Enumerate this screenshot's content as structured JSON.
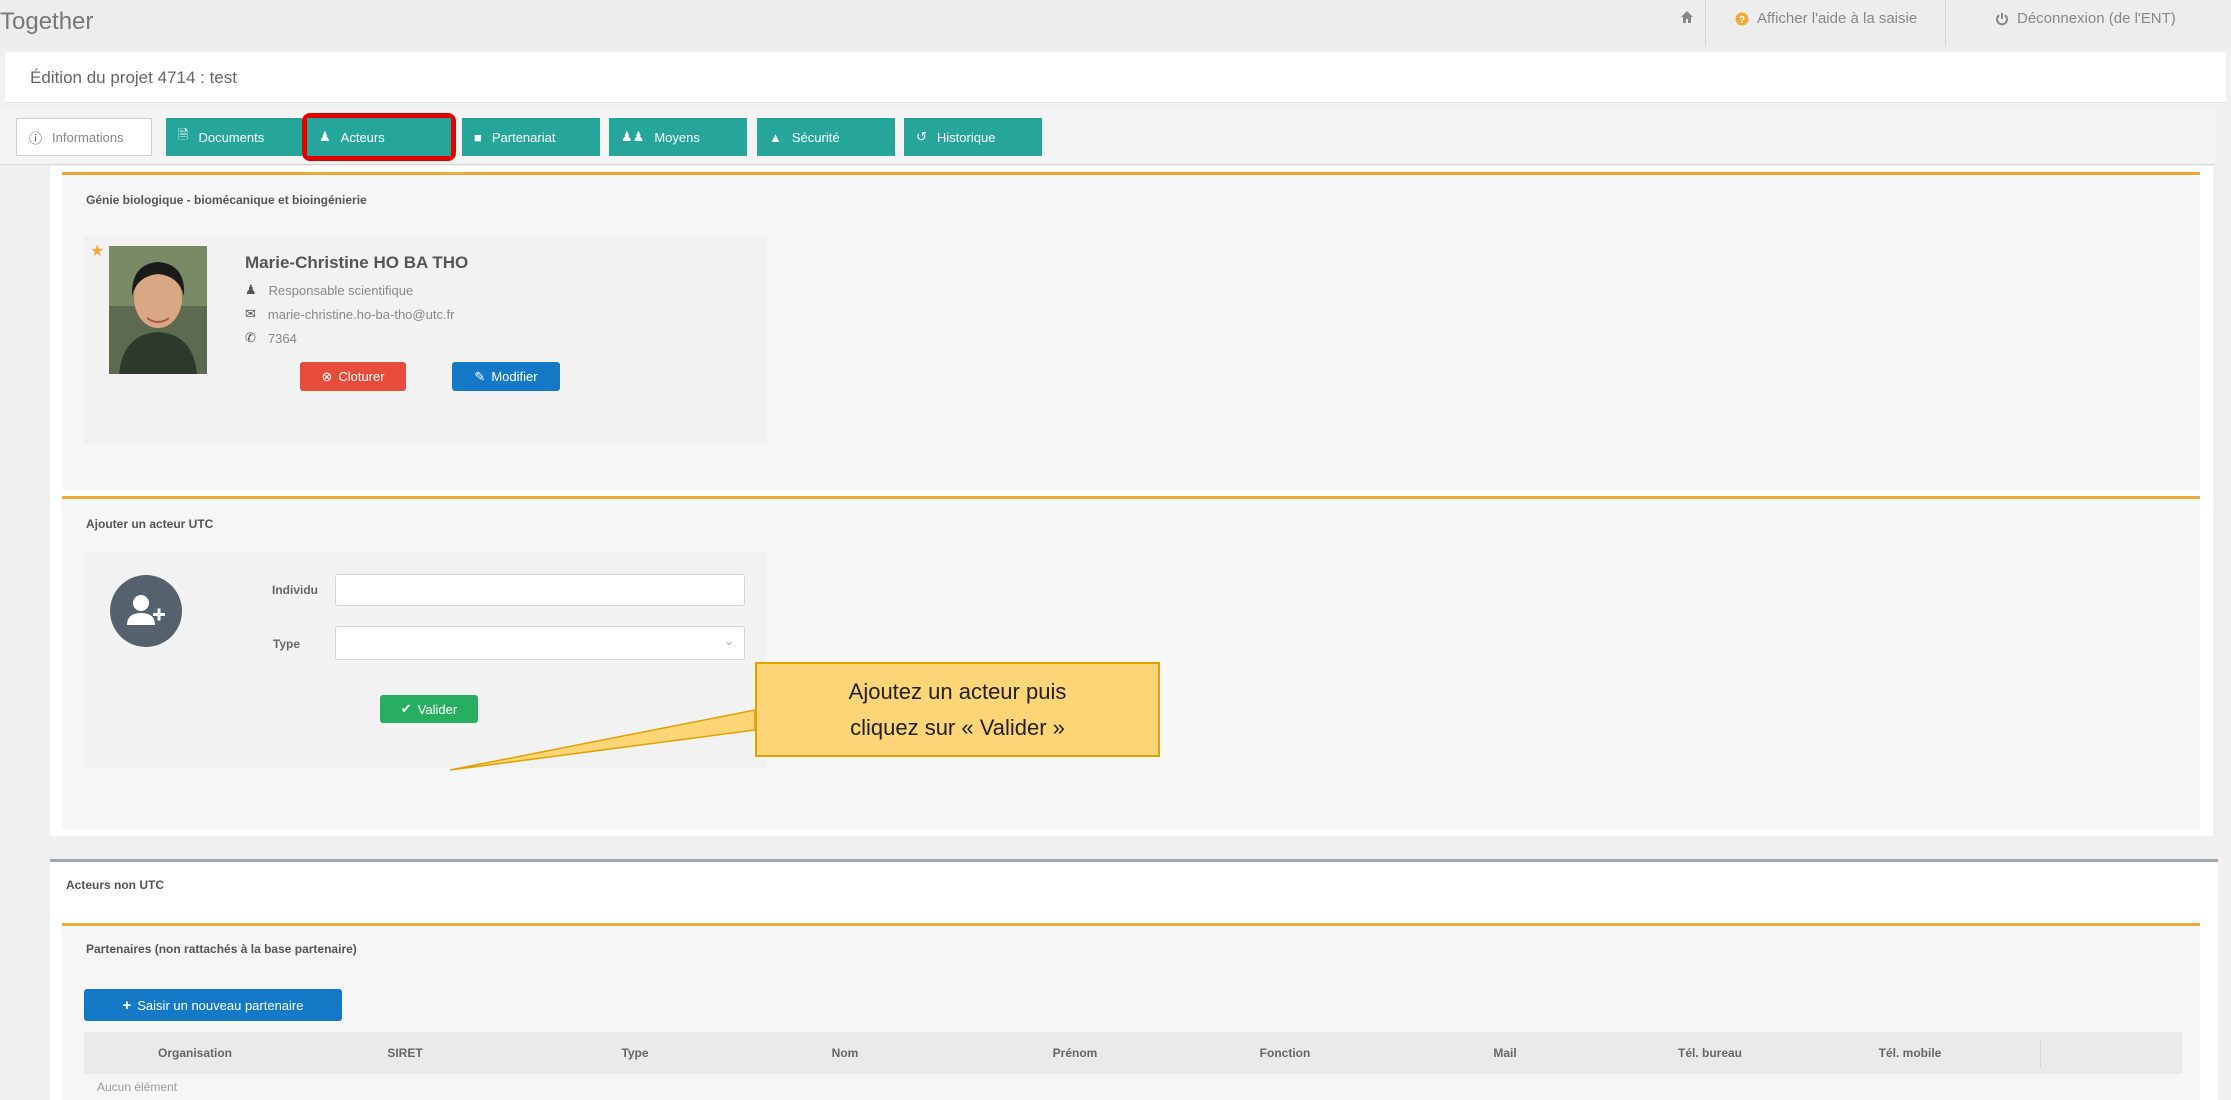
{
  "app": {
    "brand": "Together",
    "nav": {
      "home_icon": "home-icon",
      "help_label": "Afficher l'aide à la saisie",
      "logout_label": "Déconnexion (de l'ENT)"
    }
  },
  "project": {
    "title": "Édition du projet 4714 : test"
  },
  "tabs": [
    {
      "label": "Informations",
      "icon": "info-icon"
    },
    {
      "label": "Documents",
      "icon": "document-icon"
    },
    {
      "label": "Acteurs",
      "icon": "user-icon"
    },
    {
      "label": "Partenariat",
      "icon": "square-icon"
    },
    {
      "label": "Moyens",
      "icon": "users-icon"
    },
    {
      "label": "Sécurité",
      "icon": "warning-icon"
    },
    {
      "label": "Historique",
      "icon": "history-icon"
    }
  ],
  "actors": {
    "section_title": "Génie biologique - biomécanique et bioingénierie",
    "person": {
      "name": "Marie-Christine HO BA THO",
      "role": "Responsable scientifique",
      "email": "marie-christine.ho-ba-tho@utc.fr",
      "phone": "7364"
    },
    "close_label": "Cloturer",
    "edit_label": "Modifier"
  },
  "add_actor": {
    "section_title": "Ajouter un acteur UTC",
    "individual_label": "Individu",
    "individual_value": "",
    "type_label": "Type",
    "type_value": "",
    "submit_label": "Valider"
  },
  "callout": {
    "line1": "Ajoutez un acteur puis",
    "line2": "cliquez sur « Valider »"
  },
  "non_utc": {
    "section_title": "Acteurs non UTC",
    "partners_title": "Partenaires (non rattachés à la base partenaire)",
    "new_partner_label": "Saisir un nouveau partenaire",
    "columns": [
      "Organisation",
      "SIRET",
      "Type",
      "Nom",
      "Prénom",
      "Fonction",
      "Mail",
      "Tél. bureau",
      "Tél. mobile"
    ],
    "empty_text": "Aucun élément"
  },
  "colors": {
    "tab_teal": "#26a69a",
    "accent_orange": "#f0a838",
    "danger_red": "#e74c3c",
    "primary_blue": "#1479c6",
    "success_green": "#27ae60",
    "highlight_red": "#e30000"
  }
}
